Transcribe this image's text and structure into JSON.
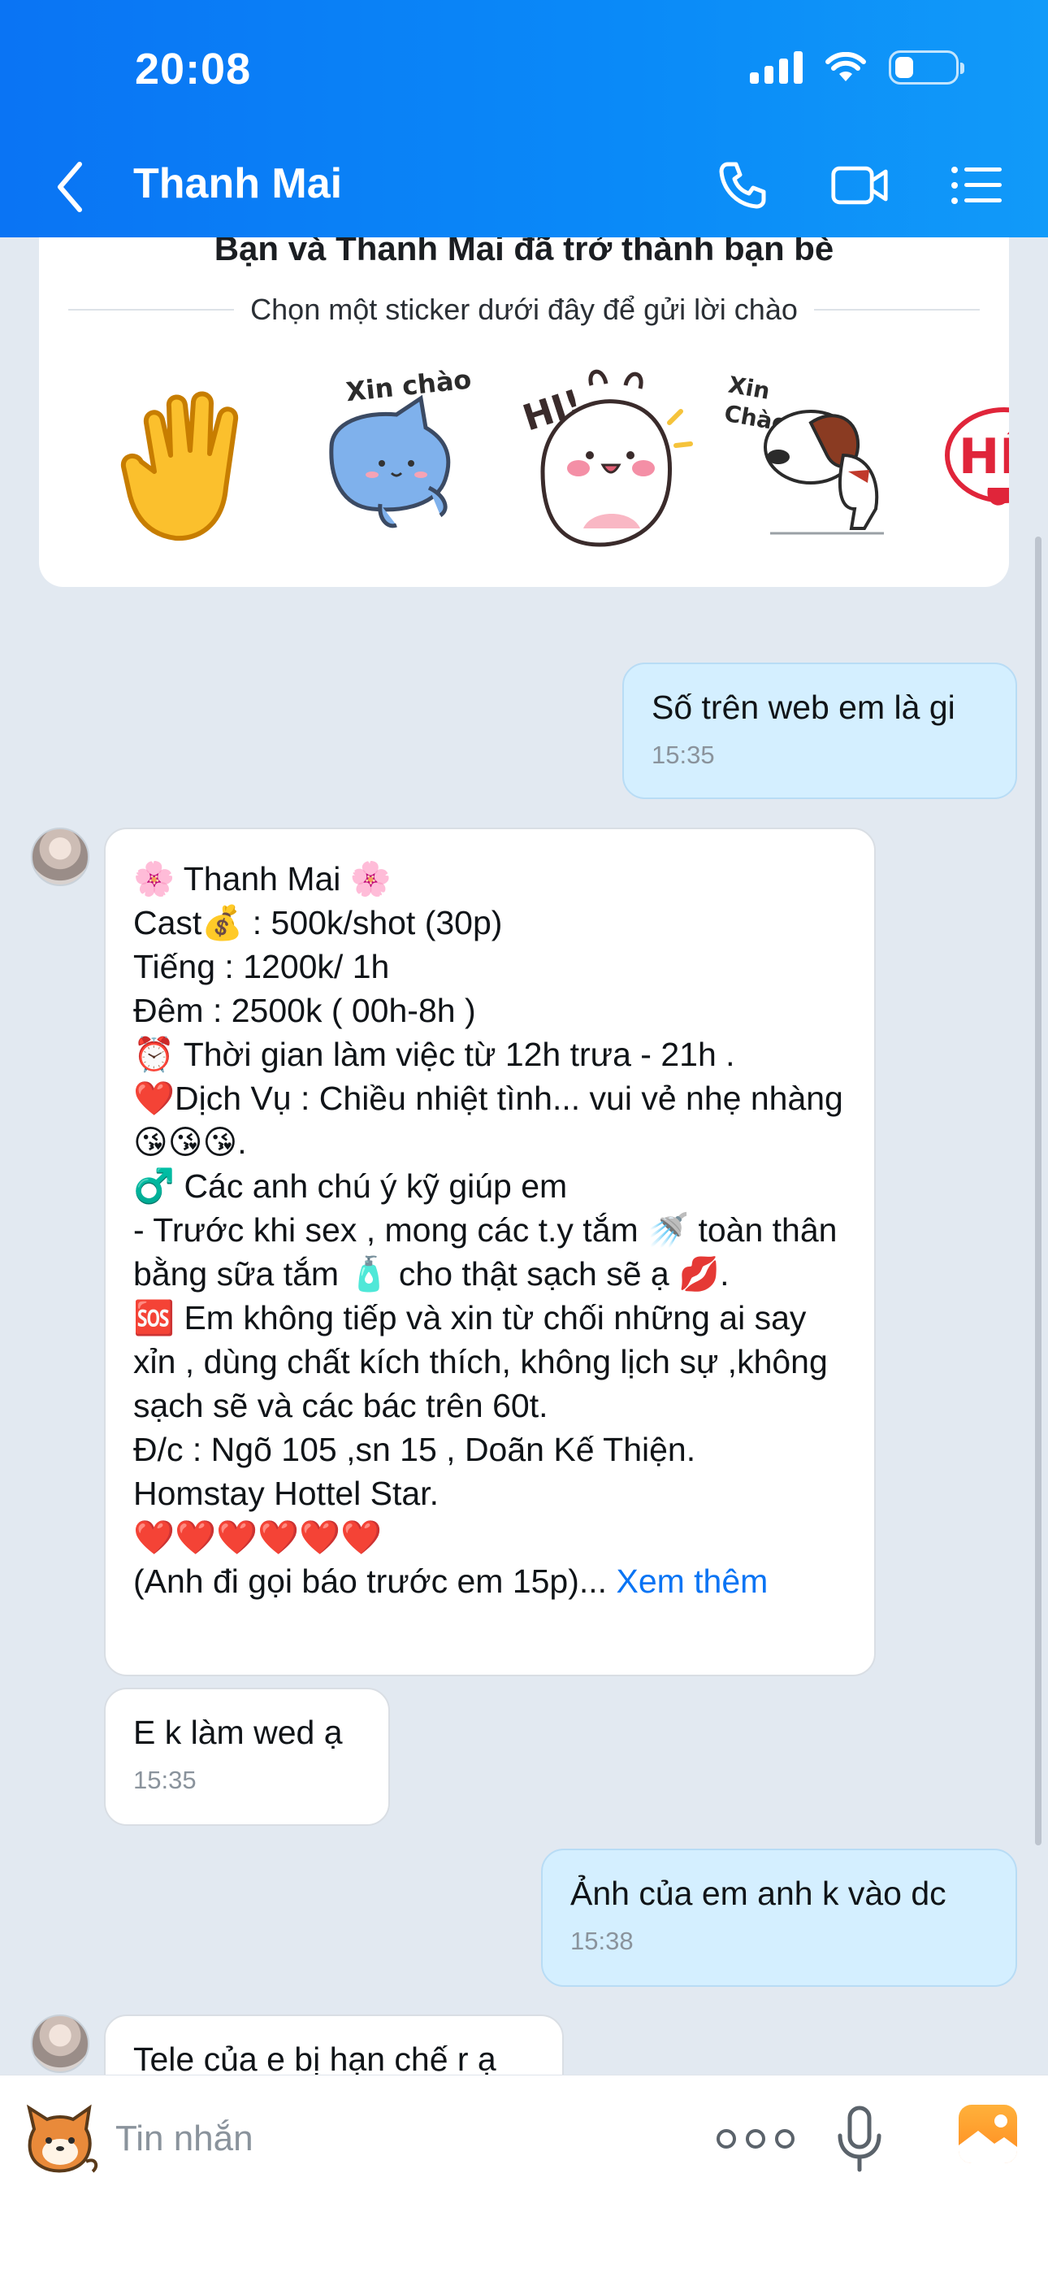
{
  "status_bar": {
    "time": "20:08",
    "battery_level": 0.32
  },
  "header": {
    "title": "Thanh Mai"
  },
  "icons": [
    "back-icon",
    "phone-icon",
    "video-call-icon",
    "menu-list-icon",
    "signal-icon",
    "wifi-icon",
    "battery-icon",
    "mic-icon",
    "image-icon",
    "more-icon"
  ],
  "sticker_panel": {
    "friend_text": "Bạn và Thanh Mai đã trở thành bạn bè",
    "hint": "Chọn một sticker dưới đây để gửi lời chào",
    "stickers": [
      {
        "name": "wave-hand-sticker",
        "text": ""
      },
      {
        "name": "blue-cat-sticker",
        "text": "Xin chào"
      },
      {
        "name": "bunny-hi-sticker",
        "text": "HI!"
      },
      {
        "name": "dog-bow-sticker",
        "text": "Xin Chào"
      },
      {
        "name": "partial-sticker",
        "text": "HÊ"
      }
    ]
  },
  "messages": [
    {
      "direction": "out",
      "text": "Số trên web em là gi",
      "time": "15:35"
    },
    {
      "direction": "in",
      "text": "🌸 Thanh Mai 🌸\nCast💰 : 500k/shot (30p)\nTiếng : 1200k/ 1h\nĐêm : 2500k ( 00h-8h )\n⏰ Thời gian làm việc từ 12h trưa - 21h .\n❤️Dịch Vụ : Chiều nhiệt tình... vui vẻ nhẹ nhàng 😘😘😘.\n♂️ Các anh chú ý kỹ giúp em\n- Trước khi sex , mong các t.y tắm 🚿 toàn thân bằng sữa tắm 🧴 cho thật sạch sẽ ạ 💋.\n🆘 Em không tiếp và xin từ chối những ai say xỉn , dùng chất kích thích, không lịch sự ,không sạch sẽ và các bác trên 60t.\nĐ/c : Ngõ 105 ,sn 15 , Doãn Kế Thiện.\nHomstay Hottel Star.\n          ❤️❤️❤️❤️❤️❤️\n(Anh đi gọi báo trước em 15p)...",
      "see_more": "Xem thêm"
    },
    {
      "direction": "in",
      "text": "E k làm wed ạ",
      "time": "15:35"
    },
    {
      "direction": "out",
      "text": "Ảnh của em anh k vào dc",
      "time": "15:38"
    },
    {
      "direction": "in",
      "text": "Tele của e bị hạn chế r ạ"
    }
  ],
  "composer": {
    "placeholder": "Tin nhắn"
  }
}
